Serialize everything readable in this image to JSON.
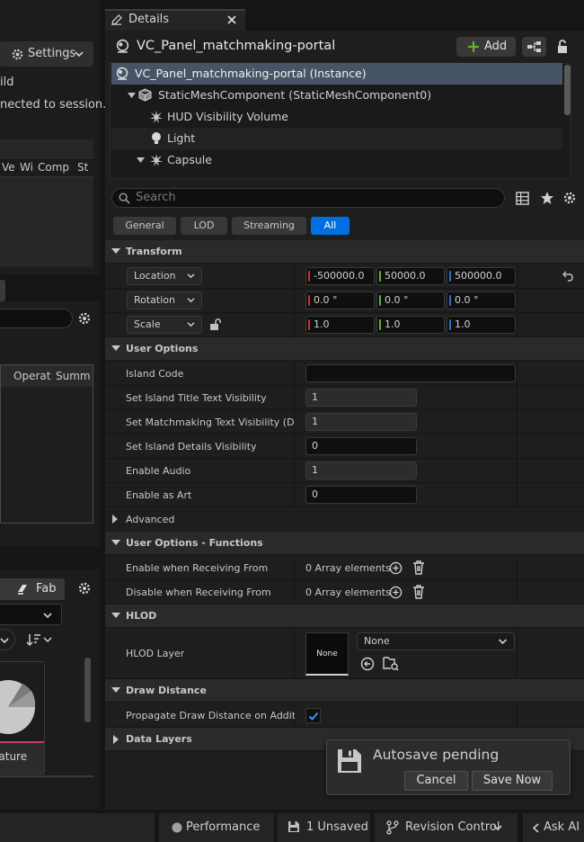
{
  "left_panel": {
    "settings_label": "Settings",
    "text_line1": "ild",
    "text_line2": "nected to session.",
    "columns": [
      "Ve",
      "Wi",
      "Comp",
      "St"
    ],
    "columns2": [
      "Operat",
      "Summ"
    ],
    "fab_label": "Fab",
    "asset_label": "eature"
  },
  "details": {
    "tab_label": "Details",
    "actor_name": "VC_Panel_matchmaking-portal",
    "add_label": "Add",
    "tree": [
      {
        "label": "VC_Panel_matchmaking-portal (Instance)"
      },
      {
        "label": "StaticMeshComponent (StaticMeshComponent0)"
      },
      {
        "label": "HUD Visibility Volume"
      },
      {
        "label": "Light"
      },
      {
        "label": "Capsule"
      }
    ],
    "search_placeholder": "Search",
    "filters": [
      "General",
      "LOD",
      "Streaming",
      "All"
    ],
    "transform": {
      "title": "Transform",
      "location_label": "Location",
      "location": [
        "-500000.0",
        "50000.0",
        "500000.0"
      ],
      "rotation_label": "Rotation",
      "rotation": [
        "0.0 °",
        "0.0 °",
        "0.0 °"
      ],
      "scale_label": "Scale",
      "scale": [
        "1.0",
        "1.0",
        "1.0"
      ]
    },
    "user_options": {
      "title": "User Options",
      "rows": [
        {
          "label": "Island Code",
          "value": ""
        },
        {
          "label": "Set Island Title Text Visibility",
          "value": "1"
        },
        {
          "label": "Set Matchmaking Text Visibility (D...",
          "value": "1"
        },
        {
          "label": "Set Island Details Visibility",
          "value": "0"
        },
        {
          "label": "Enable Audio",
          "value": "1"
        },
        {
          "label": "Enable as Art",
          "value": "0"
        }
      ],
      "advanced_label": "Advanced"
    },
    "functions": {
      "title": "User Options - Functions",
      "rows": [
        {
          "label": "Enable when Receiving From",
          "value": "0 Array elements"
        },
        {
          "label": "Disable when Receiving From",
          "value": "0 Array elements"
        }
      ]
    },
    "hlod": {
      "title": "HLOD",
      "layer_label": "HLOD Layer",
      "thumb_label": "None",
      "select_value": "None"
    },
    "draw_distance": {
      "title": "Draw Distance",
      "propagate_label": "Propagate Draw Distance on Additi...",
      "checked": true
    },
    "data_layers_title": "Data Layers"
  },
  "autosave": {
    "title": "Autosave pending",
    "cancel_label": "Cancel",
    "save_label": "Save Now"
  },
  "statusbar": {
    "performance": "Performance",
    "unsaved": "1 Unsaved",
    "revision": "Revision Control",
    "ask": "Ask AI"
  },
  "colors": {
    "accent": "#0070e0",
    "x_axis": "#d03030",
    "y_axis": "#6ab030",
    "z_axis": "#2f6fd8"
  }
}
